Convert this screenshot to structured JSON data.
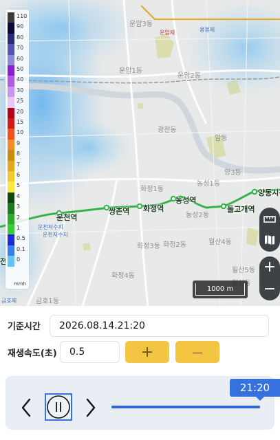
{
  "legend": {
    "rows": [
      {
        "value": "110",
        "color": "#3a3a3a"
      },
      {
        "value": "90",
        "color": "#0a0a3a"
      },
      {
        "value": "80",
        "color": "#2a2a7a"
      },
      {
        "value": "70",
        "color": "#5656b0"
      },
      {
        "value": "60",
        "color": "#8a8ad6"
      },
      {
        "value": "50",
        "color": "#8a1fd8"
      },
      {
        "value": "40",
        "color": "#b05ae8"
      },
      {
        "value": "30",
        "color": "#c896f0"
      },
      {
        "value": "25",
        "color": "#e8c8f4"
      },
      {
        "value": "20",
        "color": "#b0001a"
      },
      {
        "value": "15",
        "color": "#d61818"
      },
      {
        "value": "10",
        "color": "#f05020"
      },
      {
        "value": "9",
        "color": "#f38a2a"
      },
      {
        "value": "8",
        "color": "#c88a10"
      },
      {
        "value": "7",
        "color": "#e0a820"
      },
      {
        "value": "6",
        "color": "#f0cc30"
      },
      {
        "value": "5",
        "color": "#f8e840"
      },
      {
        "value": "4",
        "color": "#0c4a0c"
      },
      {
        "value": "3",
        "color": "#207a20"
      },
      {
        "value": "2",
        "color": "#2ea82e"
      },
      {
        "value": "1",
        "color": "#36cc36"
      },
      {
        "value": "0.5",
        "color": "#1e2ad8"
      },
      {
        "value": "0.1",
        "color": "#3a7ef0"
      },
      {
        "value": "0",
        "color": "#66c4f4"
      }
    ],
    "unit": "mmh"
  },
  "map": {
    "places": [
      "운암3동",
      "운암1동",
      "운암2동",
      "광천동",
      "임동",
      "양3동",
      "화정1동",
      "농성1동",
      "농성2동",
      "화정3동",
      "화정2동",
      "월산4동",
      "월산5동",
      "월산동",
      "화정4동",
      "금호1동"
    ],
    "stations": [
      "운천역",
      "쌍촌역",
      "화정역",
      "농성역",
      "돌고개역",
      "양동시장"
    ],
    "water_labels": [
      "운천저수지",
      "운천저수지",
      "금호제"
    ],
    "poi_labels": [
      "운암제",
      "용봉제"
    ],
    "scale_label": "1000 m",
    "line_color": "#34b34a"
  },
  "controls": {
    "base_time_label": "기준시간",
    "base_time_value": "2026.08.14.21:20",
    "speed_label": "재생속도(초)",
    "speed_value": "0.5",
    "plus_label": "+",
    "minus_label": "—"
  },
  "player": {
    "current_time": "21:20",
    "progress": 1.0
  }
}
